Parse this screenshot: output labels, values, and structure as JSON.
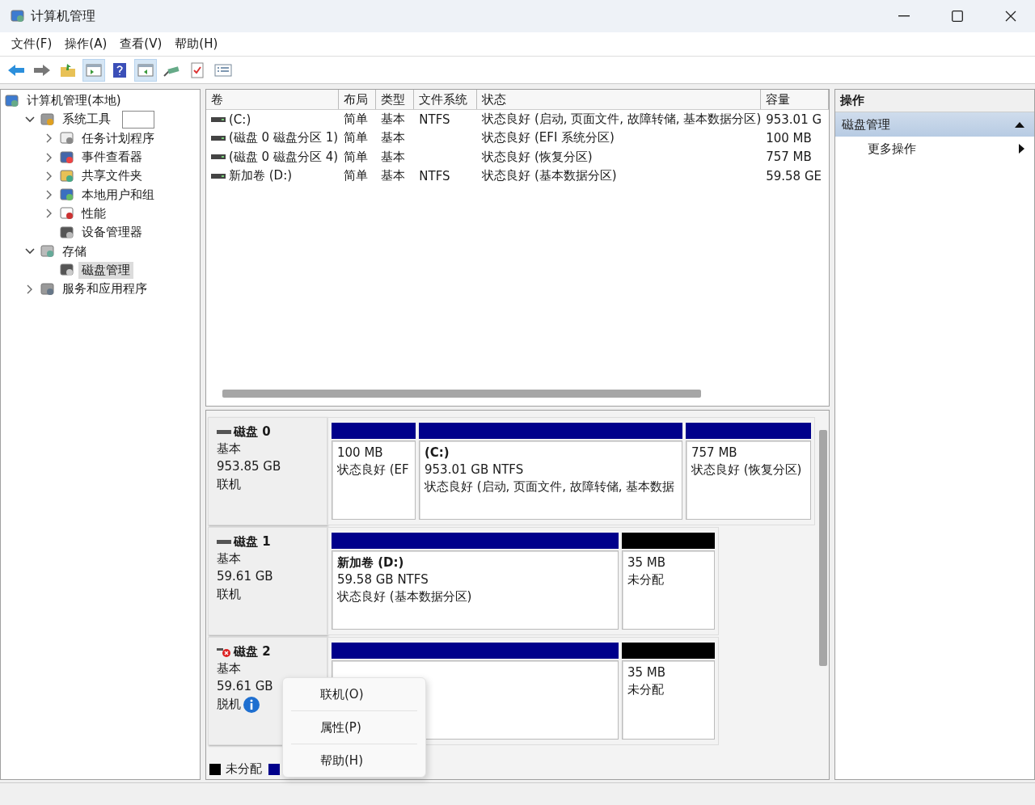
{
  "window": {
    "title": "计算机管理"
  },
  "menu": [
    "文件(F)",
    "操作(A)",
    "查看(V)",
    "帮助(H)"
  ],
  "toolbar": [
    {
      "kind": "back",
      "pressed": false
    },
    {
      "kind": "forward",
      "pressed": false
    },
    {
      "kind": "up",
      "pressed": false
    },
    {
      "kind": "tree",
      "pressed": true
    },
    {
      "kind": "help",
      "pressed": false
    },
    {
      "kind": "pane",
      "pressed": true
    },
    {
      "kind": "connect",
      "pressed": false
    },
    {
      "kind": "check",
      "pressed": false
    },
    {
      "kind": "list",
      "pressed": false
    }
  ],
  "tree": [
    {
      "label": "计算机管理(本地)",
      "selected": false,
      "edit_box": false,
      "children": [
        {
          "label": "系统工具",
          "expanded": true,
          "selected": false,
          "edit_box": true,
          "children": [
            {
              "label": "任务计划程序",
              "expanded": false,
              "selected": false,
              "edit_box": false
            },
            {
              "label": "事件查看器",
              "expanded": false,
              "selected": false,
              "edit_box": false
            },
            {
              "label": "共享文件夹",
              "expanded": false,
              "selected": false,
              "edit_box": false
            },
            {
              "label": "本地用户和组",
              "expanded": false,
              "selected": false,
              "edit_box": false
            },
            {
              "label": "性能",
              "expanded": false,
              "selected": false,
              "edit_box": false
            },
            {
              "label": "设备管理器",
              "selected": false,
              "edit_box": false
            }
          ]
        },
        {
          "label": "存储",
          "expanded": true,
          "selected": false,
          "edit_box": false,
          "children": [
            {
              "label": "磁盘管理",
              "selected": true,
              "edit_box": false
            }
          ]
        },
        {
          "label": "服务和应用程序",
          "expanded": false,
          "selected": false,
          "edit_box": false
        }
      ]
    }
  ],
  "table": {
    "columns": [
      "卷",
      "布局",
      "类型",
      "文件系统",
      "状态",
      "容量"
    ],
    "rows": [
      [
        "(C:)",
        "简单",
        "基本",
        "NTFS",
        "状态良好 (启动, 页面文件, 故障转储, 基本数据分区)",
        "953.01 G"
      ],
      [
        "(磁盘 0 磁盘分区 1)",
        "简单",
        "基本",
        "",
        "状态良好 (EFI 系统分区)",
        "100 MB"
      ],
      [
        "(磁盘 0 磁盘分区 4)",
        "简单",
        "基本",
        "",
        "状态良好 (恢复分区)",
        "757 MB"
      ],
      [
        "新加卷 (D:)",
        "简单",
        "基本",
        "NTFS",
        "状态良好 (基本数据分区)",
        "59.58 GE"
      ]
    ]
  },
  "disks": [
    {
      "name": "磁盘 0",
      "type": "基本",
      "size": "953.85 GB",
      "status": "联机",
      "offline": false,
      "partitions": [
        {
          "kind": "primary",
          "size": "100 MB",
          "status": "状态良好 (EF"
        },
        {
          "kind": "primary",
          "title": "(C:)",
          "size": "953.01 GB NTFS",
          "status": "状态良好 (启动, 页面文件, 故障转储, 基本数据"
        },
        {
          "kind": "primary",
          "size": "757 MB",
          "status": "状态良好 (恢复分区)"
        }
      ]
    },
    {
      "name": "磁盘 1",
      "type": "基本",
      "size": "59.61 GB",
      "status": "联机",
      "offline": false,
      "partitions": [
        {
          "kind": "primary",
          "title": "新加卷 (D:)",
          "size": "59.58 GB NTFS",
          "status": "状态良好 (基本数据分区)"
        },
        {
          "kind": "unallocated",
          "size": "35 MB",
          "status": "未分配"
        }
      ]
    },
    {
      "name": "磁盘 2",
      "type": "基本",
      "size": "59.61 GB",
      "status": "脱机",
      "offline": true,
      "partitions": [
        {
          "kind": "primary"
        },
        {
          "kind": "unallocated",
          "size": "35 MB",
          "status": "未分配"
        }
      ]
    }
  ],
  "legend": [
    {
      "kind": "unallocated",
      "label": "未分配"
    },
    {
      "kind": "primary"
    }
  ],
  "context_menu": [
    "联机(O)",
    "属性(P)",
    "帮助(H)"
  ],
  "actions": {
    "header": "操作",
    "section": {
      "label": "磁盘管理",
      "expanded": true
    },
    "items": [
      "更多操作"
    ]
  }
}
